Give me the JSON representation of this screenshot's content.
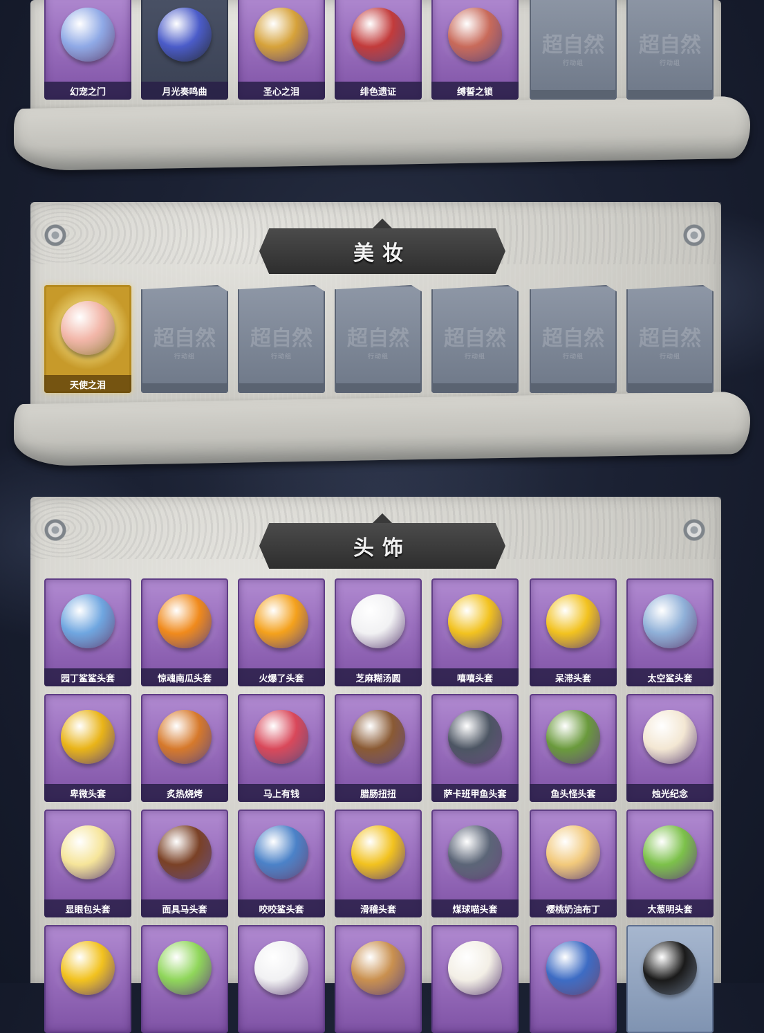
{
  "sections": [
    {
      "id": "top-row",
      "items": [
        {
          "label": "幻宠之门",
          "style": "purple",
          "icon": "pet-gate-icon",
          "color": "#8fa9e6"
        },
        {
          "label": "月光奏鸣曲",
          "style": "dark",
          "icon": "piano-icon",
          "color": "#4b5cc9"
        },
        {
          "label": "圣心之泪",
          "style": "purple",
          "icon": "scepter-icon",
          "color": "#d6a23a"
        },
        {
          "label": "绯色遗证",
          "style": "purple",
          "icon": "sword-icon",
          "color": "#c23b3b"
        },
        {
          "label": "缚誓之锁",
          "style": "purple",
          "icon": "chain-icon",
          "color": "#c86a5a"
        },
        {
          "label": "",
          "style": "empty",
          "icon": "locked-card-icon",
          "color": "#8e97a6"
        },
        {
          "label": "",
          "style": "empty",
          "icon": "locked-card-icon",
          "color": "#8e97a6"
        }
      ]
    },
    {
      "id": "makeup",
      "title": "美妆",
      "items": [
        {
          "label": "天使之泪",
          "style": "gold",
          "icon": "angel-head-icon",
          "color": "#f2b6a8"
        },
        {
          "label": "",
          "style": "empty",
          "icon": "locked-card-icon",
          "color": "#8e97a6"
        },
        {
          "label": "",
          "style": "empty",
          "icon": "locked-card-icon",
          "color": "#8e97a6"
        },
        {
          "label": "",
          "style": "empty",
          "icon": "locked-card-icon",
          "color": "#8e97a6"
        },
        {
          "label": "",
          "style": "empty",
          "icon": "locked-card-icon",
          "color": "#8e97a6"
        },
        {
          "label": "",
          "style": "empty",
          "icon": "locked-card-icon",
          "color": "#8e97a6"
        },
        {
          "label": "",
          "style": "empty",
          "icon": "locked-card-icon",
          "color": "#8e97a6"
        }
      ]
    },
    {
      "id": "headwear",
      "title": "头饰",
      "items": [
        {
          "label": "园丁鲨鲨头套",
          "style": "purple",
          "icon": "shark-head-icon",
          "color": "#6fa6e0"
        },
        {
          "label": "惊魂南瓜头套",
          "style": "purple",
          "icon": "pumpkin-head-icon",
          "color": "#f08a1c"
        },
        {
          "label": "火爆了头套",
          "style": "purple",
          "icon": "fire-head-icon",
          "color": "#f4a11c"
        },
        {
          "label": "芝麻糊汤圆",
          "style": "purple",
          "icon": "dumpling-head-icon",
          "color": "#f1f1f3"
        },
        {
          "label": "嘻嘻头套",
          "style": "purple",
          "icon": "grin-emoji-icon",
          "color": "#f2c21f"
        },
        {
          "label": "呆滞头套",
          "style": "purple",
          "icon": "dazed-emoji-icon",
          "color": "#f2c21f"
        },
        {
          "label": "太空鲨头套",
          "style": "purple",
          "icon": "space-shark-icon",
          "color": "#8fb0d8"
        },
        {
          "label": "卑微头套",
          "style": "purple",
          "icon": "humble-emoji-icon",
          "color": "#e9b418"
        },
        {
          "label": "炙热烧烤",
          "style": "purple",
          "icon": "bbq-head-icon",
          "color": "#d6792b"
        },
        {
          "label": "马上有钱",
          "style": "purple",
          "icon": "horse-head-icon",
          "color": "#d9485a"
        },
        {
          "label": "腊肠扭扭",
          "style": "purple",
          "icon": "dachshund-head-icon",
          "color": "#8a5a34"
        },
        {
          "label": "萨卡班甲鱼头套",
          "style": "purple",
          "icon": "fish-head-icon",
          "color": "#4c5563"
        },
        {
          "label": "鱼头怪头套",
          "style": "purple",
          "icon": "fishman-head-icon",
          "color": "#6a9a3c"
        },
        {
          "label": "烛光纪念",
          "style": "purple",
          "icon": "candle-head-icon",
          "color": "#f3e7d3"
        },
        {
          "label": "显眼包头套",
          "style": "purple",
          "icon": "bulb-head-icon",
          "color": "#f6e59a"
        },
        {
          "label": "面具马头套",
          "style": "purple",
          "icon": "horse-mask-icon",
          "color": "#7a4126"
        },
        {
          "label": "咬咬鲨头套",
          "style": "purple",
          "icon": "biting-shark-icon",
          "color": "#4b82c8"
        },
        {
          "label": "滑稽头套",
          "style": "purple",
          "icon": "funny-emoji-icon",
          "color": "#f2c21f"
        },
        {
          "label": "煤球喵头套",
          "style": "purple",
          "icon": "cat-head-icon",
          "color": "#5b6577"
        },
        {
          "label": "樱桃奶油布丁",
          "style": "purple",
          "icon": "pudding-head-icon",
          "color": "#f2c97b"
        },
        {
          "label": "大葱明头套",
          "style": "purple",
          "icon": "scallion-head-icon",
          "color": "#7cc14a"
        },
        {
          "label": "",
          "style": "purple",
          "icon": "pikachu-head-icon",
          "color": "#f2c21f"
        },
        {
          "label": "",
          "style": "purple",
          "icon": "sprout-head-icon",
          "color": "#8fd65a"
        },
        {
          "label": "",
          "style": "purple",
          "icon": "sheep-head-icon",
          "color": "#f1f1f3"
        },
        {
          "label": "",
          "style": "purple",
          "icon": "doge-sunglasses-icon",
          "color": "#c9904f"
        },
        {
          "label": "",
          "style": "purple",
          "icon": "radish-head-icon",
          "color": "#f3efe6"
        },
        {
          "label": "",
          "style": "purple",
          "icon": "winter-hat-icon",
          "color": "#3d6cc4"
        },
        {
          "label": "",
          "style": "blue",
          "icon": "pixel-sunglasses-icon",
          "color": "#1a1a1a"
        }
      ]
    }
  ],
  "watermark": {
    "main": "超自然",
    "sub": "行动组"
  }
}
